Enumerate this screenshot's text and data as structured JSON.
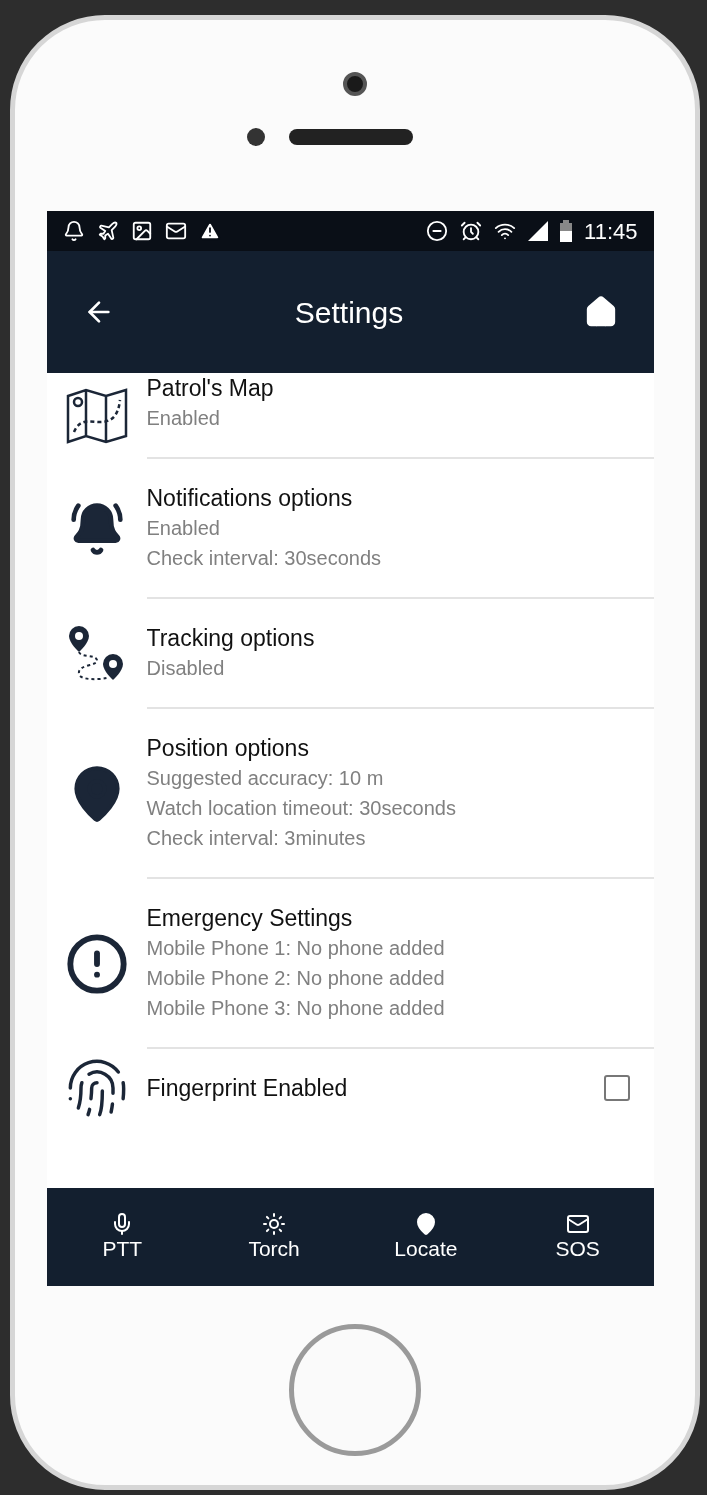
{
  "status_bar": {
    "time": "11:45"
  },
  "header": {
    "title": "Settings"
  },
  "settings": [
    {
      "kind": "info",
      "title": "Patrol's Map",
      "lines": [
        "Enabled"
      ]
    },
    {
      "kind": "info",
      "title": "Notifications options",
      "lines": [
        "Enabled",
        "Check interval: 30seconds"
      ]
    },
    {
      "kind": "info",
      "title": "Tracking options",
      "lines": [
        "Disabled"
      ]
    },
    {
      "kind": "info",
      "title": "Position options",
      "lines": [
        "Suggested accuracy: 10 m",
        "Watch location timeout: 30seconds",
        "Check interval: 3minutes"
      ]
    },
    {
      "kind": "info",
      "title": "Emergency Settings",
      "lines": [
        "Mobile Phone 1: No phone added",
        "Mobile Phone 2: No phone added",
        "Mobile Phone 3: No phone added"
      ]
    },
    {
      "kind": "checkbox",
      "title": "Fingerprint Enabled",
      "checked": false
    }
  ],
  "bottom_nav": [
    {
      "label": "PTT"
    },
    {
      "label": "Torch"
    },
    {
      "label": "Locate"
    },
    {
      "label": "SOS"
    }
  ]
}
